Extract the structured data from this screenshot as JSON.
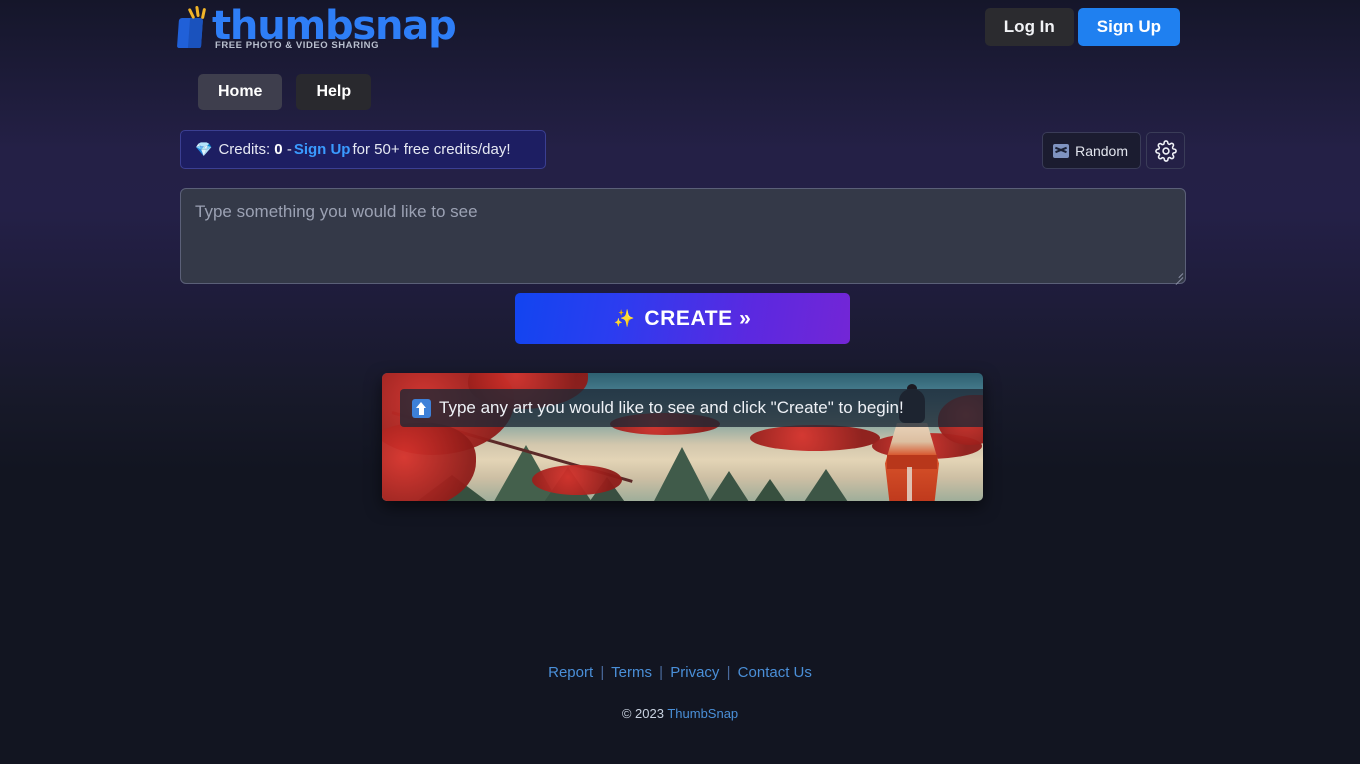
{
  "header": {
    "logo": {
      "name": "thumbsnap",
      "tagline": "FREE PHOTO & VIDEO SHARING",
      "mark_icon": "thumbnail-flash-icon",
      "brand_color": "#2e7ef7"
    },
    "login_label": "Log In",
    "signup_label": "Sign Up"
  },
  "nav": {
    "items": [
      {
        "label": "Home",
        "active": true
      },
      {
        "label": "Help",
        "active": false
      }
    ]
  },
  "credits": {
    "gem_icon": "gem-icon",
    "prefix": "Credits:",
    "amount": "0",
    "dash": "-",
    "signup_link": "Sign Up",
    "suffix": "for 50+ free credits/day!"
  },
  "tools": {
    "random_label": "Random",
    "random_icon": "shuffle-icon",
    "settings_icon": "gear-icon"
  },
  "prompt": {
    "placeholder": "Type something you would like to see",
    "value": ""
  },
  "create_button": {
    "icon": "sparkles-icon",
    "label": "CREATE »",
    "gradient_from": "#1245f0",
    "gradient_to": "#7326d6"
  },
  "preview": {
    "overlay_icon": "upload-arrow-icon",
    "overlay_text": "Type any art you would like to see and click \"Create\" to begin!",
    "alt": "anime landscape with red maple trees, green mountains and a figure in a red kimono"
  },
  "footer": {
    "links": [
      {
        "label": "Report"
      },
      {
        "label": "Terms"
      },
      {
        "label": "Privacy"
      },
      {
        "label": "Contact Us"
      }
    ],
    "separator": "|",
    "copyright_prefix": "© 2023",
    "copyright_brand": "ThumbSnap"
  }
}
